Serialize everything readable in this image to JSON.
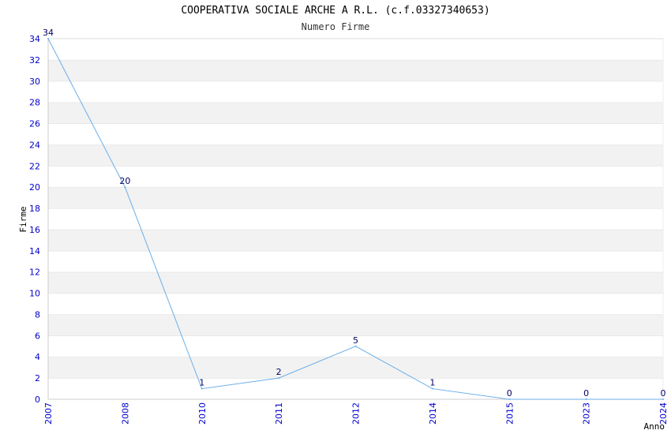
{
  "chart_data": {
    "type": "line",
    "title": "COOPERATIVA SOCIALE ARCHE A R.L. (c.f.03327340653)",
    "subtitle": "Numero Firme",
    "xlabel": "Anno",
    "ylabel": "Firme",
    "categories": [
      "2007",
      "2008",
      "2010",
      "2011",
      "2012",
      "2014",
      "2015",
      "2023",
      "2024"
    ],
    "series": [
      {
        "values": [
          34,
          20,
          1,
          2,
          5,
          1,
          0,
          0,
          0
        ]
      }
    ],
    "ylim": [
      0,
      34
    ],
    "yticks": [
      0,
      2,
      4,
      6,
      8,
      10,
      12,
      14,
      16,
      18,
      20,
      22,
      24,
      26,
      28,
      30,
      32,
      34
    ],
    "grid": "horizontal bands",
    "colors": {
      "line": "#6aaee8",
      "band": "#f2f2f2",
      "tick_text": "#0000cc",
      "data_label": "#000066"
    }
  }
}
